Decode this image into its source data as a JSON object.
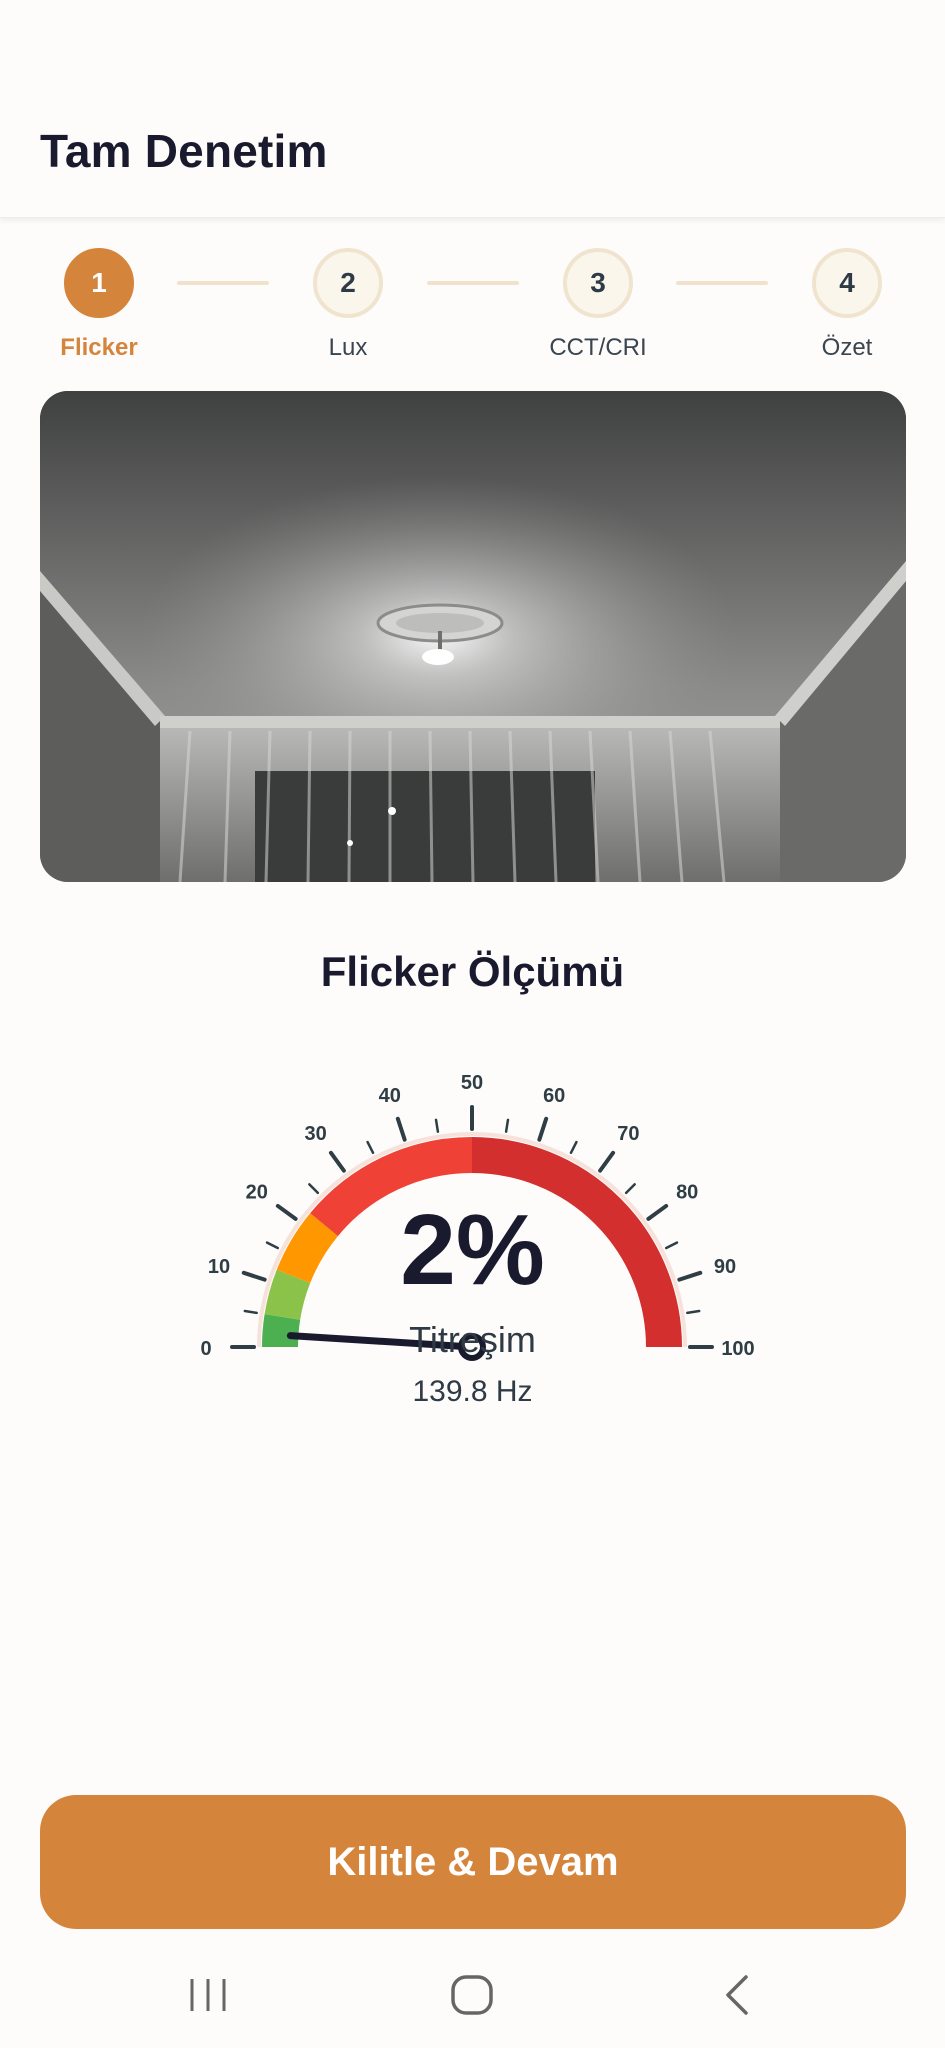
{
  "header": {
    "title": "Tam Denetim"
  },
  "stepper": {
    "steps": [
      {
        "number": "1",
        "label": "Flicker",
        "active": true
      },
      {
        "number": "2",
        "label": "Lux",
        "active": false
      },
      {
        "number": "3",
        "label": "CCT/CRI",
        "active": false
      },
      {
        "number": "4",
        "label": "Özet",
        "active": false
      }
    ]
  },
  "measurement": {
    "title": "Flicker Ölçümü",
    "value": "2%",
    "value_number": 2,
    "label": "Titreşim",
    "frequency": "139.8 Hz",
    "scale_min": 0,
    "scale_max": 100,
    "tick_labels": [
      "0",
      "10",
      "20",
      "30",
      "40",
      "50",
      "60",
      "70",
      "80",
      "90",
      "100"
    ],
    "bands": [
      {
        "from": 0,
        "to": 5,
        "color": "#4caf50"
      },
      {
        "from": 5,
        "to": 12,
        "color": "#8bc34a"
      },
      {
        "from": 12,
        "to": 22,
        "color": "#ff9800"
      },
      {
        "from": 22,
        "to": 50,
        "color": "#f04136"
      },
      {
        "from": 50,
        "to": 100,
        "color": "#d32f2f"
      }
    ]
  },
  "actions": {
    "primary_label": "Kilitle & Devam"
  },
  "nav": {
    "recents": "recents-icon",
    "home": "home-icon",
    "back": "back-icon"
  },
  "colors": {
    "accent": "#d4853b",
    "text": "#1a1a2e"
  }
}
